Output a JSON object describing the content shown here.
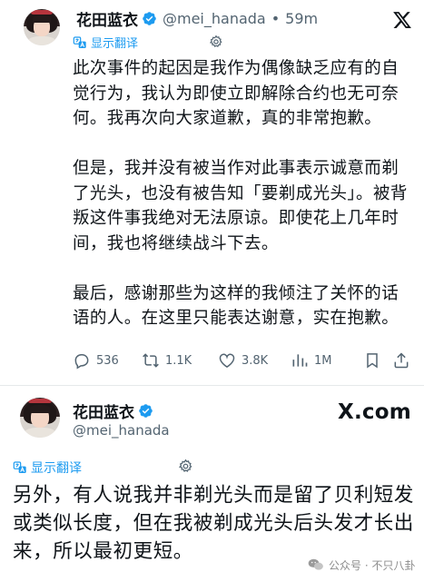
{
  "post1": {
    "display_name": "花田蓝衣",
    "handle": "@mei_hanada",
    "separator": "•",
    "time": "59m",
    "translate_label": "显示翻译",
    "paragraphs": [
      "此次事件的起因是我作为偶像缺乏应有的自觉行为，我认为即使立即解除合约也无可奈何。我再次向大家道歉，真的非常抱歉。",
      "但是，我并没有被当作对此事表示诚意而剃了光头，也没有被告知「要剃成光头」。被背叛这件事我绝对无法原谅。即使花上几年时间，我也将继续战斗下去。",
      "最后，感谢那些为这样的我倾注了关怀的话语的人。在这里只能表达谢意，实在抱歉。"
    ],
    "actions": {
      "replies": "536",
      "reposts": "1.1K",
      "likes": "3.8K",
      "views": "1M"
    }
  },
  "post2": {
    "display_name": "花田蓝衣",
    "handle": "@mei_hanada",
    "brand_x": "X",
    "brand_com": ".com",
    "translate_label": "显示翻译",
    "text": "另外，有人说我并非剃光头而是留了贝利短发或类似长度，但在我被剃成光头后头发才长出来，所以最初更短。"
  },
  "watermark": {
    "text": "公众号 · 不只八卦"
  },
  "colors": {
    "accent": "#1d9bf0",
    "secondary_text": "#536471",
    "primary_text": "#0f1419"
  },
  "icons": [
    "x-logo-icon",
    "verified-badge-icon",
    "translate-icon",
    "gear-icon",
    "reply-icon",
    "repost-icon",
    "like-icon",
    "views-icon",
    "bookmark-icon",
    "share-icon"
  ]
}
